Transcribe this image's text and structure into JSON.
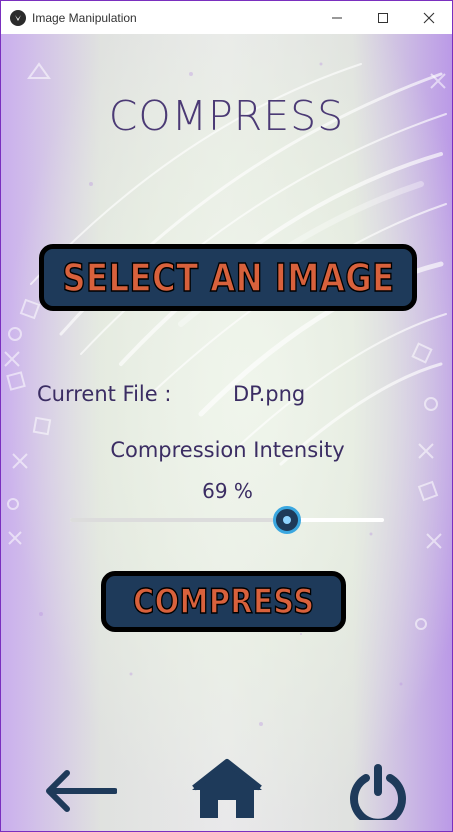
{
  "window": {
    "title": "Image Manipulation",
    "controls": [
      "minimize-icon",
      "maximize-icon",
      "close-icon"
    ]
  },
  "page": {
    "heading": "COMPRESS"
  },
  "select_button": {
    "label": "SELECT AN IMAGE"
  },
  "file": {
    "label": "Current File :",
    "value": "DP.png"
  },
  "compression": {
    "label": "Compression Intensity",
    "value_text": "69 %",
    "value": 69,
    "min": 0,
    "max": 100
  },
  "compress_button": {
    "label": "COMPRESS"
  },
  "bottom_nav": {
    "icons": [
      "back-arrow-icon",
      "home-icon",
      "power-icon"
    ]
  },
  "colors": {
    "heading": "#4b3a75",
    "button_bg": "#1e3a5a",
    "button_text": "#d8613c",
    "button_border": "#000000",
    "text": "#3b2d63",
    "slider_thumb_ring": "#3aa7e0",
    "window_border": "#7a2fbf"
  }
}
